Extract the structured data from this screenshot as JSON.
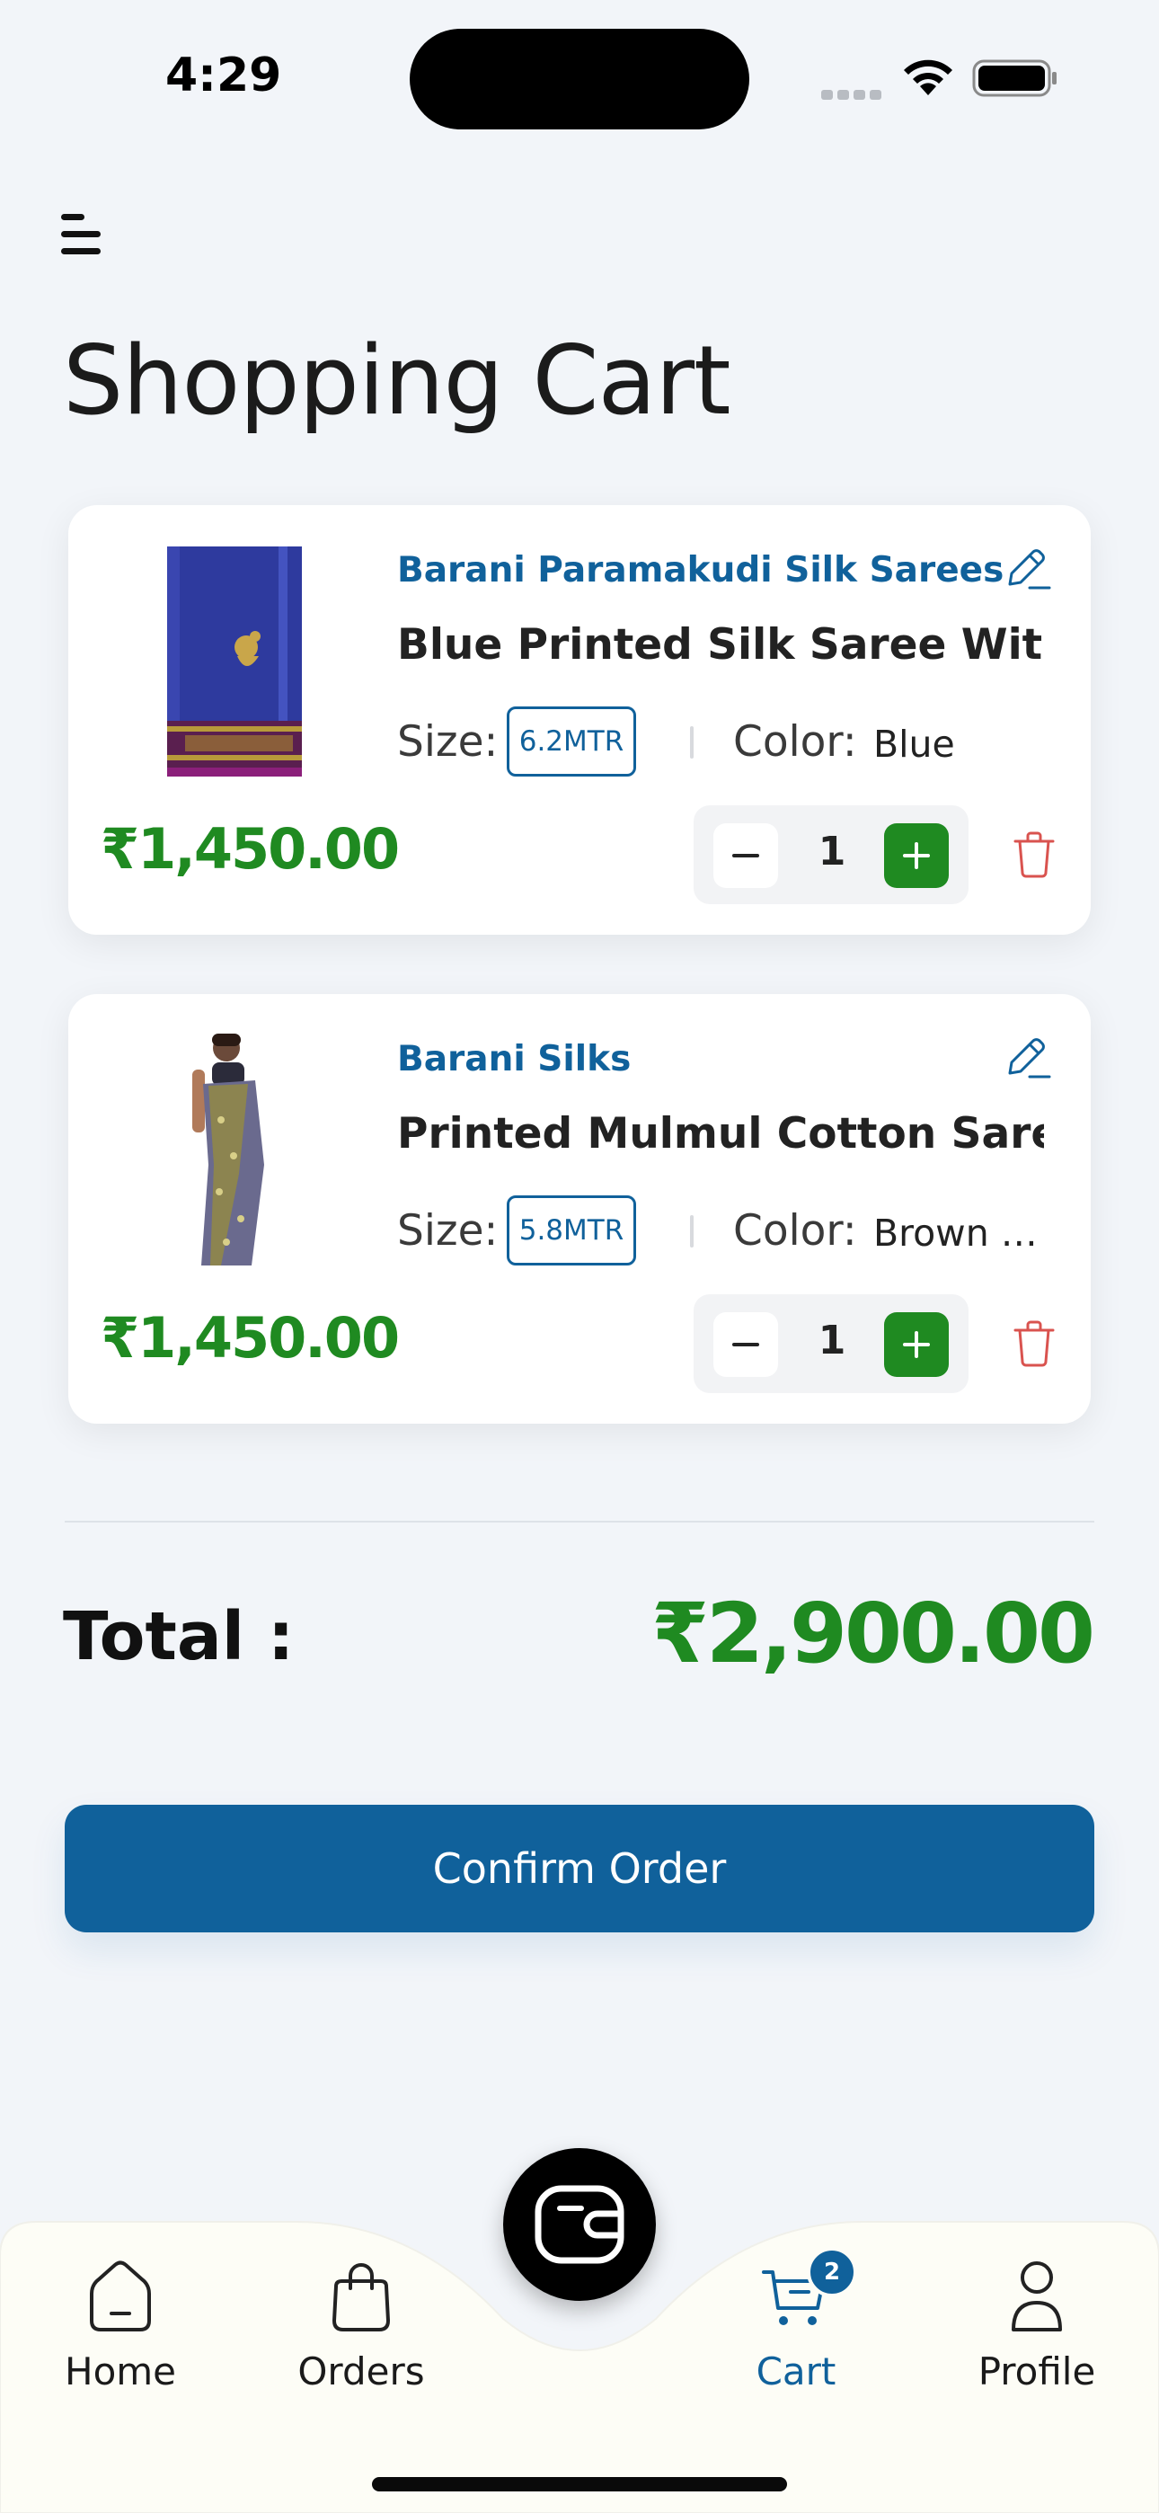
{
  "status_bar": {
    "time": "4:29"
  },
  "header": {
    "title": "Shopping Cart"
  },
  "cart_items": [
    {
      "shop": "Barani Paramakudi Silk Sarees",
      "name": "Blue Printed Silk Saree With",
      "size_label": "Size:",
      "size": "6.2MTR",
      "color_label": "Color:",
      "color": "Blue",
      "price": "₹1,450.00",
      "quantity": "1"
    },
    {
      "shop": "Barani Silks",
      "name": "Printed Mulmul Cotton Saree",
      "size_label": "Size:",
      "size": "5.8MTR",
      "color_label": "Color:",
      "color": "Brown a...",
      "price": "₹1,450.00",
      "quantity": "1"
    }
  ],
  "summary": {
    "total_label": "Total :",
    "total_value": "₹2,900.00"
  },
  "confirm_button": "Confirm Order",
  "bottom_nav": {
    "items": [
      {
        "label": "Home",
        "icon": "home-icon"
      },
      {
        "label": "Orders",
        "icon": "bag-icon"
      },
      {
        "label": "Cart",
        "icon": "cart-icon",
        "badge": "2",
        "active": true
      },
      {
        "label": "Profile",
        "icon": "profile-icon"
      }
    ],
    "center_icon": "wallet-icon"
  },
  "colors": {
    "primary": "#10619b",
    "price_green": "#1f8a21",
    "delete_red": "#d9534f",
    "background": "#f2f5f9"
  }
}
